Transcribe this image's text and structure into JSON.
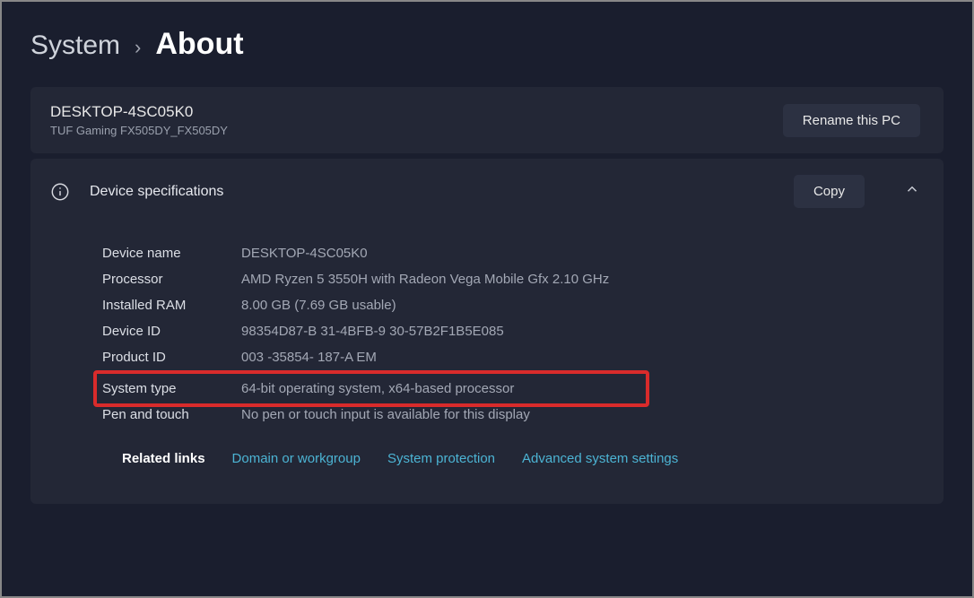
{
  "breadcrumb": {
    "parent": "System",
    "separator": "›",
    "current": "About"
  },
  "device": {
    "name": "DESKTOP-4SC05K0",
    "model": "TUF Gaming FX505DY_FX505DY",
    "rename_button": "Rename this PC"
  },
  "spec_section": {
    "title": "Device specifications",
    "copy_button": "Copy"
  },
  "specs": {
    "device_name": {
      "label": "Device name",
      "value": "DESKTOP-4SC05K0"
    },
    "processor": {
      "label": "Processor",
      "value": "AMD Ryzen 5 3550H with Radeon Vega Mobile Gfx    2.10 GHz"
    },
    "ram": {
      "label": "Installed RAM",
      "value": "8.00 GB (7.69 GB usable)"
    },
    "device_id": {
      "label": "Device ID",
      "value": "98354D87-B   31-4BFB-9   30-57B2F1B5E085"
    },
    "product_id": {
      "label": "Product ID",
      "value": "003   -35854-   187-A   EM"
    },
    "system_type": {
      "label": "System type",
      "value": "64-bit operating system, x64-based processor"
    },
    "pen_touch": {
      "label": "Pen and touch",
      "value": "No pen or touch input is available for this display"
    }
  },
  "related": {
    "label": "Related links",
    "links": {
      "domain": "Domain or workgroup",
      "protection": "System protection",
      "advanced": "Advanced system settings"
    }
  }
}
